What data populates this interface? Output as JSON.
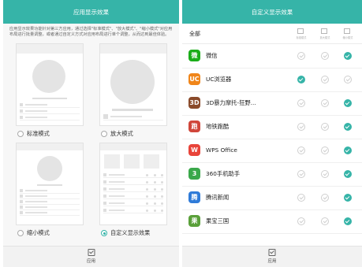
{
  "left_screen": {
    "title": "应用显示效果",
    "description": "应用显示效果功能针对第三方应用，通过选择\"标准模式\"、\"放大模式\"、\"缩小模式\"对应用布局进行批量调整，或者通过自定义方式对应用布局进行单个调整，从而达到最佳体验。",
    "modes": [
      {
        "label": "标准模式",
        "selected": false
      },
      {
        "label": "放大模式",
        "selected": false
      },
      {
        "label": "缩小模式",
        "selected": false
      },
      {
        "label": "自定义显示效果",
        "selected": true
      }
    ],
    "apply_label": "应用"
  },
  "right_screen": {
    "title": "自定义显示效果",
    "header_all": "全部",
    "column_captions": [
      "标准模式",
      "放大模式",
      "缩小模式"
    ],
    "apps": [
      {
        "name": "微信",
        "icon": "wechat-icon",
        "color": "#1aad19",
        "mode": 3
      },
      {
        "name": "UC浏览器",
        "icon": "uc-browser-icon",
        "color": "#f08519",
        "mode": 1
      },
      {
        "name": "3D暴力摩托-狂野...",
        "icon": "moto-game-icon",
        "color": "#8a4a2a",
        "mode": 3
      },
      {
        "name": "地铁跑酷",
        "icon": "subway-game-icon",
        "color": "#d0463a",
        "mode": 3
      },
      {
        "name": "WPS Office",
        "icon": "wps-icon",
        "color": "#e8443a",
        "mode": 3
      },
      {
        "name": "360手机助手",
        "icon": "360-icon",
        "color": "#3aa84a",
        "mode": 3
      },
      {
        "name": "腾讯新闻",
        "icon": "tencent-news-icon",
        "color": "#2f7bd8",
        "mode": 3
      },
      {
        "name": "果宝三国",
        "icon": "guobao-game-icon",
        "color": "#5aa03a",
        "mode": 3
      }
    ],
    "apply_label": "应用"
  },
  "colors": {
    "accent": "#36b4a8",
    "check_off": "#cfcfcf"
  }
}
